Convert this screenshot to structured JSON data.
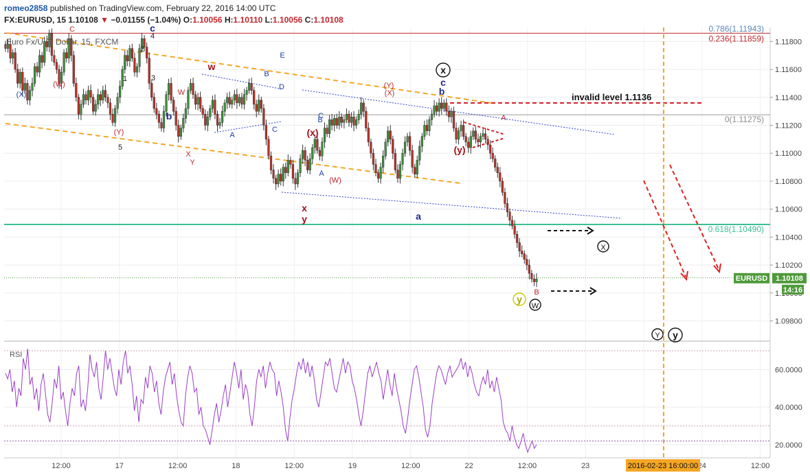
{
  "header": {
    "author": "romeo2858",
    "published": "published on TradingView.com, February 22, 2016 14:00 UTC",
    "symbol": "FX:EURUSD, 15",
    "last": "1.10108",
    "change": "−0.01155 (−1.04%)",
    "o_label": "O:",
    "o_value": "1.10056",
    "h_label": "H:",
    "h_value": "1.10110",
    "l_label": "L:",
    "l_value": "1.10056",
    "c_label": "C:",
    "c_value": "1.10108"
  },
  "chart_data": {
    "type": "candlestick",
    "legend_title": "Euro Fx/U.S. Dollar, 15, FXCM",
    "price_axis": {
      "ylim": [
        1.0966,
        1.119
      ],
      "ticks": [
        "1.11800",
        "1.11600",
        "1.11400",
        "1.11200",
        "1.11000",
        "1.10800",
        "1.10600",
        "1.10400",
        "1.10200",
        "1.10000",
        "1.09800"
      ],
      "tick_values": [
        1.118,
        1.116,
        1.114,
        1.112,
        1.11,
        1.108,
        1.106,
        1.104,
        1.102,
        1.1,
        1.098
      ]
    },
    "time_axis": {
      "labels": [
        "12:00",
        "17",
        "12:00",
        "18",
        "12:00",
        "19",
        "12:00",
        "22",
        "12:00",
        "23",
        "12:00",
        "24",
        "12:00"
      ],
      "cursor_label": "2016-02-23 16:00:00"
    },
    "current_price": {
      "symbol": "EURUSD",
      "value": "1.10108",
      "countdown": "14:16",
      "price": 1.10108
    },
    "fib_levels": [
      {
        "label": "0.236(1.11859)",
        "price": 1.11859,
        "color": "#c0272d"
      },
      {
        "label": "0(1.11275)",
        "price": 1.11275,
        "color": "#8a8a8a"
      },
      {
        "label": "0.618(1.10490)",
        "price": 1.1049,
        "color": "#3dbf91"
      },
      {
        "label": "0.786(1.11943)",
        "price": 1.11943,
        "color": "#5d86b8"
      }
    ],
    "annotations": {
      "invalid_level": "invalid level 1.1136",
      "invalid_price": 1.1136
    },
    "wave_labels": [
      {
        "text": "(X)",
        "color": "#1e40a0",
        "size": 11
      },
      {
        "text": "(W)",
        "color": "#c0272d",
        "size": 11
      },
      {
        "text": "(Y)",
        "color": "#c0272d",
        "size": 11
      },
      {
        "text": "1",
        "color": "#222222",
        "size": 11
      },
      {
        "text": "2",
        "color": "#222222",
        "size": 11
      },
      {
        "text": "3",
        "color": "#222222",
        "size": 11
      },
      {
        "text": "4",
        "color": "#222222",
        "size": 11
      },
      {
        "text": "5",
        "color": "#222222",
        "size": 11
      },
      {
        "text": "b",
        "color": "#1e2a8a",
        "size": 14,
        "bold": true
      },
      {
        "text": "W",
        "color": "#c0272d",
        "size": 11
      },
      {
        "text": "X",
        "color": "#c0272d",
        "size": 11
      },
      {
        "text": "Y",
        "color": "#c0272d",
        "size": 11
      },
      {
        "text": "w",
        "color": "#a0141a",
        "size": 14,
        "bold": true
      },
      {
        "text": "A",
        "color": "#1e40a0",
        "size": 11
      },
      {
        "text": "B",
        "color": "#1e40a0",
        "size": 11
      },
      {
        "text": "C",
        "color": "#1e40a0",
        "size": 11
      },
      {
        "text": "D",
        "color": "#1e40a0",
        "size": 11
      },
      {
        "text": "E",
        "color": "#1e40a0",
        "size": 11
      },
      {
        "text": "x",
        "color": "#a0141a",
        "size": 14,
        "bold": true
      },
      {
        "text": "y",
        "color": "#a0141a",
        "size": 14,
        "bold": true
      },
      {
        "text": "(x)",
        "color": "#a0141a",
        "size": 14,
        "bold": true
      },
      {
        "text": "A",
        "color": "#1e40a0",
        "size": 11
      },
      {
        "text": "B",
        "color": "#1e40a0",
        "size": 11
      },
      {
        "text": "C",
        "color": "#1e40a0",
        "size": 11
      },
      {
        "text": "(W)",
        "color": "#c0272d",
        "size": 11
      },
      {
        "text": "(X)",
        "color": "#c0272d",
        "size": 11
      },
      {
        "text": "(Y)",
        "color": "#c0272d",
        "size": 11
      },
      {
        "text": "a",
        "color": "#1e2a8a",
        "size": 14,
        "bold": true
      },
      {
        "text": "b",
        "color": "#1e2a8a",
        "size": 14,
        "bold": true
      },
      {
        "text": "c",
        "color": "#1e2a8a",
        "size": 14,
        "bold": true
      },
      {
        "text": "(y)",
        "color": "#a0141a",
        "size": 14,
        "bold": true
      },
      {
        "text": "A",
        "color": "#c0272d",
        "size": 11
      },
      {
        "text": "B",
        "color": "#c0272d",
        "size": 11
      },
      {
        "text": "C",
        "color": "#c0272d",
        "size": 11
      },
      {
        "text": "c",
        "color": "#1e2a8a",
        "size": 14,
        "bold": true
      },
      {
        "text": "(X)",
        "color": "#c0272d",
        "size": 11
      },
      {
        "text": "5",
        "color": "#222222",
        "size": 11
      }
    ],
    "circled_labels": [
      {
        "text": "x",
        "color": "#111111",
        "ring": "#111111",
        "bold": true
      },
      {
        "text": "X",
        "color": "#111111",
        "ring": "#111111",
        "bold": false
      },
      {
        "text": "W",
        "color": "#111111",
        "ring": "#111111",
        "bold": false
      },
      {
        "text": "y",
        "color": "#a8a800",
        "ring": "#c8c800",
        "bold": true
      },
      {
        "text": "Y",
        "color": "#111111",
        "ring": "#111111",
        "bold": false
      },
      {
        "text": "y",
        "color": "#111111",
        "ring": "#111111",
        "bold": true
      }
    ],
    "rsi": {
      "label": "RSI",
      "ticks": [
        "60.0000",
        "40.0000",
        "20.0000"
      ],
      "tick_values": [
        60,
        40,
        20
      ],
      "ylim": [
        13,
        74
      ],
      "bands": [
        70,
        30,
        22
      ],
      "values": [
        58,
        55,
        60,
        48,
        54,
        40,
        50,
        46,
        66,
        60,
        71,
        52,
        56,
        44,
        50,
        38,
        52,
        58,
        47,
        36,
        32,
        42,
        55,
        50,
        62,
        44,
        48,
        38,
        30,
        42,
        50,
        46,
        58,
        62,
        40,
        44,
        38,
        50,
        68,
        60,
        56,
        64,
        50,
        44,
        56,
        70,
        60,
        66,
        58,
        50,
        46,
        60,
        52,
        64,
        70,
        58,
        62,
        52,
        38,
        46,
        32,
        44,
        42,
        56,
        50,
        62,
        58,
        48,
        54,
        42,
        36,
        48,
        56,
        60,
        64,
        52,
        58,
        46,
        38,
        32,
        30,
        46,
        56,
        62,
        58,
        48,
        50,
        36,
        40,
        30,
        28,
        24,
        20,
        28,
        36,
        42,
        32,
        38,
        46,
        52,
        40,
        48,
        56,
        64,
        58,
        50,
        60,
        44,
        52,
        48,
        36,
        30,
        40,
        54,
        60,
        56,
        62,
        50,
        58,
        64,
        60,
        58,
        46,
        54,
        48,
        40,
        28,
        22,
        34,
        44,
        50,
        58,
        64,
        60,
        66,
        58,
        64,
        56,
        62,
        54,
        44,
        40,
        48,
        56,
        64,
        62,
        66,
        58,
        50,
        48,
        54,
        60,
        66,
        58,
        64,
        62,
        54,
        50,
        44,
        36,
        30,
        38,
        48,
        58,
        62,
        56,
        60,
        64,
        58,
        54,
        44,
        52,
        60,
        52,
        46,
        58,
        50,
        44,
        38,
        30,
        26,
        34,
        44,
        52,
        60,
        62,
        56,
        48,
        40,
        28,
        24,
        30,
        42,
        50,
        58,
        62,
        60,
        56,
        52,
        58,
        62,
        56,
        58,
        60,
        62,
        66,
        60,
        64,
        56,
        62,
        58,
        52,
        48,
        46,
        52,
        56,
        52,
        60,
        50,
        54,
        48,
        56,
        50,
        44,
        32,
        28,
        26,
        22,
        30,
        24,
        20,
        18,
        22,
        26,
        20,
        16,
        19,
        22,
        18,
        20
      ]
    },
    "price_series": [
      1.1175,
      1.1178,
      1.1168,
      1.1172,
      1.116,
      1.115,
      1.1158,
      1.1145,
      1.115,
      1.1138,
      1.1145,
      1.115,
      1.1162,
      1.1158,
      1.117,
      1.1165,
      1.118,
      1.1176,
      1.1186,
      1.117,
      1.1165,
      1.116,
      1.115,
      1.1158,
      1.1172,
      1.1168,
      1.1182,
      1.117,
      1.115,
      1.114,
      1.1128,
      1.1135,
      1.1142,
      1.1138,
      1.1145,
      1.114,
      1.113,
      1.1135,
      1.1142,
      1.1138,
      1.1145,
      1.114,
      1.1136,
      1.1128,
      1.1122,
      1.1132,
      1.114,
      1.1148,
      1.116,
      1.117,
      1.1166,
      1.1175,
      1.1168,
      1.1158,
      1.1162,
      1.1175,
      1.1182,
      1.1176,
      1.1168,
      1.115,
      1.114,
      1.1132,
      1.1128,
      1.1122,
      1.1118,
      1.113,
      1.1142,
      1.115,
      1.1138,
      1.113,
      1.112,
      1.1112,
      1.1118,
      1.1125,
      1.1132,
      1.1145,
      1.115,
      1.1142,
      1.1135,
      1.114,
      1.1132,
      1.1128,
      1.112,
      1.1126,
      1.1132,
      1.1138,
      1.1128,
      1.112,
      1.1122,
      1.113,
      1.1136,
      1.114,
      1.1135,
      1.1138,
      1.1142,
      1.1136,
      1.114,
      1.1135,
      1.1142,
      1.1145,
      1.115,
      1.1145,
      1.1135,
      1.113,
      1.1138,
      1.1132,
      1.112,
      1.111,
      1.1098,
      1.1088,
      1.1082,
      1.1078,
      1.1085,
      1.108,
      1.109,
      1.1086,
      1.1095,
      1.1092,
      1.1082,
      1.1078,
      1.1086,
      1.1096,
      1.1102,
      1.1095,
      1.1088,
      1.1096,
      1.1104,
      1.111,
      1.1102,
      1.1098,
      1.1108,
      1.1118,
      1.1114,
      1.1124,
      1.112,
      1.1125,
      1.112,
      1.1126,
      1.1122,
      1.1124,
      1.1128,
      1.1122,
      1.1126,
      1.112,
      1.1124,
      1.1128,
      1.1136,
      1.113,
      1.1118,
      1.1108,
      1.11,
      1.1092,
      1.1086,
      1.1082,
      1.109,
      1.1098,
      1.1108,
      1.1116,
      1.111,
      1.11,
      1.1088,
      1.1082,
      1.1092,
      1.11,
      1.1108,
      1.1112,
      1.1102,
      1.109,
      1.1085,
      1.1095,
      1.1105,
      1.1112,
      1.112,
      1.1116,
      1.1124,
      1.1128,
      1.1134,
      1.113,
      1.1136,
      1.1132,
      1.1136,
      1.113,
      1.1126,
      1.113,
      1.1118,
      1.111,
      1.1116,
      1.112,
      1.1112,
      1.1108,
      1.1104,
      1.1112,
      1.1116,
      1.111,
      1.1108,
      1.1112,
      1.1114,
      1.111,
      1.1106,
      1.11,
      1.1096,
      1.109,
      1.1086,
      1.108,
      1.1072,
      1.1064,
      1.1058,
      1.1052,
      1.1048,
      1.1042,
      1.1036,
      1.103,
      1.1028,
      1.1024,
      1.102,
      1.1014,
      1.101,
      1.1008,
      1.101
    ]
  }
}
